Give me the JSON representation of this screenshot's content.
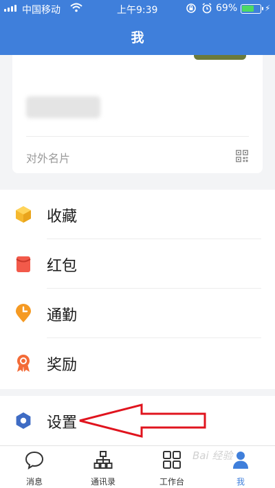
{
  "status_bar": {
    "carrier": "中国移动",
    "time": "上午9:39",
    "battery_percent": "69%",
    "battery_level": 0.69
  },
  "header": {
    "title": "我"
  },
  "profile_card": {
    "business_card_label": "对外名片"
  },
  "menu": {
    "group1": [
      {
        "label": "收藏",
        "icon": "cube-icon",
        "color": "#f5b82e"
      },
      {
        "label": "红包",
        "icon": "red-envelope-icon",
        "color": "#f25a4a"
      },
      {
        "label": "通勤",
        "icon": "clock-pin-icon",
        "color": "#f59a23"
      },
      {
        "label": "奖励",
        "icon": "medal-icon",
        "color": "#f36b38"
      }
    ],
    "group2": [
      {
        "label": "设置",
        "icon": "hexagon-settings-icon",
        "color": "#3f6cc4"
      }
    ]
  },
  "tabbar": {
    "items": [
      {
        "label": "消息",
        "icon": "chat-bubble-icon"
      },
      {
        "label": "通讯录",
        "icon": "org-chart-icon"
      },
      {
        "label": "工作台",
        "icon": "grid-icon"
      },
      {
        "label": "我",
        "icon": "person-icon",
        "active": true
      }
    ]
  },
  "watermark": "Bai 经验",
  "colors": {
    "accent": "#3f7fdb",
    "annotation": "#e0141e"
  }
}
